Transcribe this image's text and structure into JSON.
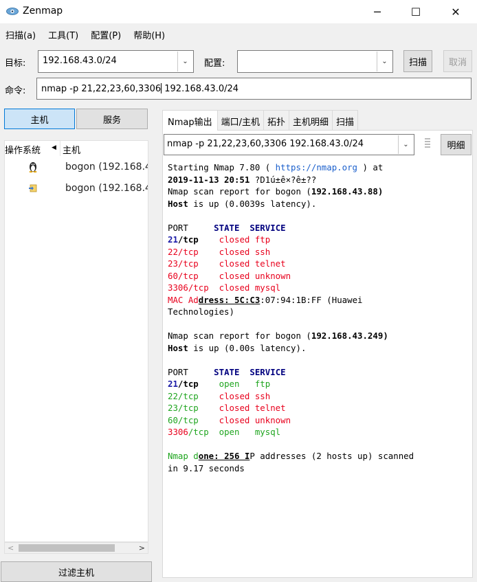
{
  "window": {
    "title": "Zenmap",
    "minimize": "─",
    "maximize": "☐",
    "close": "✕"
  },
  "menu": [
    "扫描(a)",
    "工具(T)",
    "配置(P)",
    "帮助(H)"
  ],
  "target": {
    "label": "目标:",
    "value": "192.168.43.0/24"
  },
  "profile": {
    "label": "配置:",
    "value": ""
  },
  "scan_button": "扫描",
  "cancel_button": "取消",
  "command": {
    "label": "命令:",
    "value": "nmap -p 21,22,23,60,3306 192.168.43.0/24"
  },
  "left": {
    "hosts_button": "主机",
    "services_button": "服务",
    "col_os": "操作系统",
    "col_host": "主机",
    "hosts": [
      {
        "name": "bogon (192.168.4",
        "os_icon": "linux-tux-icon"
      },
      {
        "name": "bogon (192.168.4",
        "os_icon": "unknown-os-icon"
      }
    ],
    "filter_button": "过滤主机"
  },
  "tabs": [
    "Nmap输出",
    "端口/主机",
    "拓扑",
    "主机明细",
    "扫描"
  ],
  "output": {
    "command_combo": "nmap -p 21,22,23,60,3306 192.168.43.0/24",
    "detail_button": "明细",
    "line_start_prefix": "Starting Nmap 7.80 ( ",
    "line_start_link": "https://nmap.org",
    "line_start_suffix": " ) at",
    "line_date": "2019-11-13 20:51",
    "line_date_rest": " ?D1ú±ê×?ê±??",
    "report1": "Nmap scan report for bogon (",
    "report1_ip": "192.168.43.88",
    "report1_end": ")",
    "host_up1_a": "Host",
    "host_up1_b": " is up (0.0039s latency).",
    "hdr_port": "PORT",
    "hdr_state": "STATE",
    "hdr_service": "SERVICE",
    "ports1": [
      {
        "port": "21",
        "proto": "/tcp",
        "state": "closed",
        "service": "ftp"
      },
      {
        "port": "22",
        "proto": "/tcp",
        "state": "closed",
        "service": "ssh"
      },
      {
        "port": "23",
        "proto": "/tcp",
        "state": "closed",
        "service": "telnet"
      },
      {
        "port": "60",
        "proto": "/tcp",
        "state": "closed",
        "service": "unknown"
      },
      {
        "port": "3306",
        "proto": "/tcp",
        "state": "closed",
        "service": "mysql"
      }
    ],
    "mac_a": "MAC Ad",
    "mac_b": "dress: 5C:C3",
    "mac_c": ":07:94:1B:FF (Huawei",
    "mac_d": "Technologies)",
    "report2": "Nmap scan report for bogon (",
    "report2_ip": "192.168.43.249",
    "report2_end": ")",
    "host_up2_a": "Host",
    "host_up2_b": " is up (0.00s latency).",
    "ports2": [
      {
        "port": "21",
        "proto": "/tcp",
        "state": "open",
        "service": "ftp"
      },
      {
        "port": "22",
        "proto": "/tcp",
        "state": "closed",
        "service": "ssh"
      },
      {
        "port": "23",
        "proto": "/tcp",
        "state": "closed",
        "service": "telnet"
      },
      {
        "port": "60",
        "proto": "/tcp",
        "state": "closed",
        "service": "unknown"
      },
      {
        "port": "3306",
        "proto": "/tcp",
        "state": "open",
        "service": "mysql"
      }
    ],
    "done_a": "Nmap d",
    "done_b": "one: 256 I",
    "done_c": "P addresses (2 hosts up) scanned",
    "done_d": "in 9.17 seconds"
  },
  "colors": {
    "accent": "#0078d7",
    "closed": "#e8001c",
    "open": "#1fa51f",
    "port_number": "#1a1aa6"
  }
}
